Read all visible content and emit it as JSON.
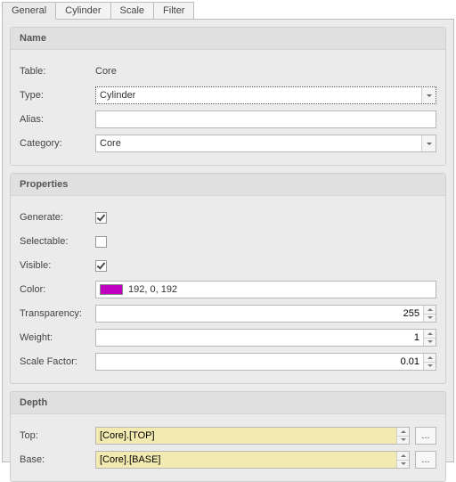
{
  "tabs": [
    "General",
    "Cylinder",
    "Scale",
    "Filter"
  ],
  "activeTab": 0,
  "groups": {
    "name": {
      "title": "Name",
      "table_label": "Table:",
      "table_value": "Core",
      "type_label": "Type:",
      "type_value": "Cylinder",
      "alias_label": "Alias:",
      "alias_value": "",
      "category_label": "Category:",
      "category_value": "Core"
    },
    "properties": {
      "title": "Properties",
      "generate_label": "Generate:",
      "generate_checked": true,
      "selectable_label": "Selectable:",
      "selectable_checked": false,
      "visible_label": "Visible:",
      "visible_checked": true,
      "color_label": "Color:",
      "color_text": "192, 0, 192",
      "color_hex": "#c000c0",
      "transparency_label": "Transparency:",
      "transparency_value": "255",
      "weight_label": "Weight:",
      "weight_value": "1",
      "scalefactor_label": "Scale Factor:",
      "scalefactor_value": "0.01"
    },
    "depth": {
      "title": "Depth",
      "top_label": "Top:",
      "top_value": "[Core].[TOP]",
      "base_label": "Base:",
      "base_value": "[Core].[BASE]",
      "browse_label": "..."
    }
  }
}
